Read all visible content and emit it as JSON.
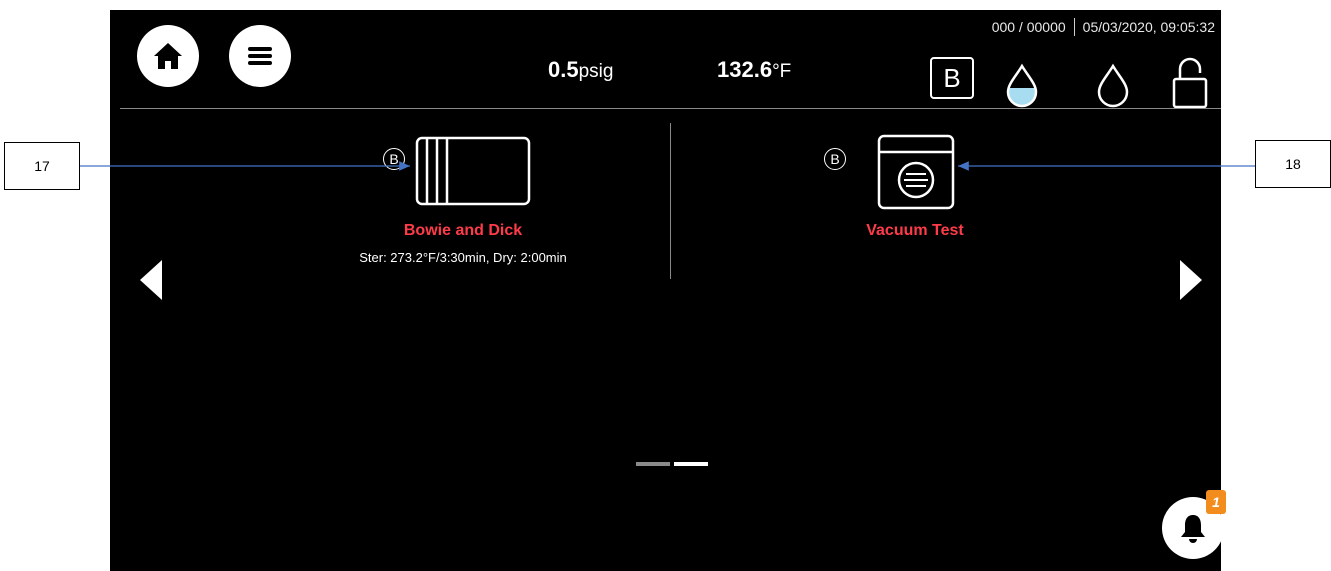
{
  "header": {
    "counter": "000 / 00000",
    "datetime": "05/03/2020, 09:05:32",
    "pressure_value": "0.5",
    "pressure_unit": "psig",
    "temperature_value": "132.6",
    "temperature_unit": "°F",
    "b_indicator": "B"
  },
  "programs": [
    {
      "badge": "B",
      "name": "Bowie and Dick",
      "params": "Ster: 273.2°F/3:30min, Dry: 2:00min"
    },
    {
      "badge": "B",
      "name": "Vacuum Test",
      "params": ""
    }
  ],
  "pagination": {
    "pages": 2,
    "current": 2
  },
  "notifications": {
    "count": "1"
  },
  "callouts": [
    {
      "label": "17"
    },
    {
      "label": "18"
    }
  ],
  "colors": {
    "program_name": "#ff3b4a",
    "water_fill": "#a8dcf0",
    "notification_badge": "#f28c1c"
  },
  "icons": {
    "home": "home-icon",
    "menu": "menu-icon",
    "water_level": "water-drop-filled-icon",
    "water_empty": "water-drop-empty-icon",
    "lock": "lock-icon",
    "bell": "bell-icon",
    "prev": "arrow-left-icon",
    "next": "arrow-right-icon"
  }
}
